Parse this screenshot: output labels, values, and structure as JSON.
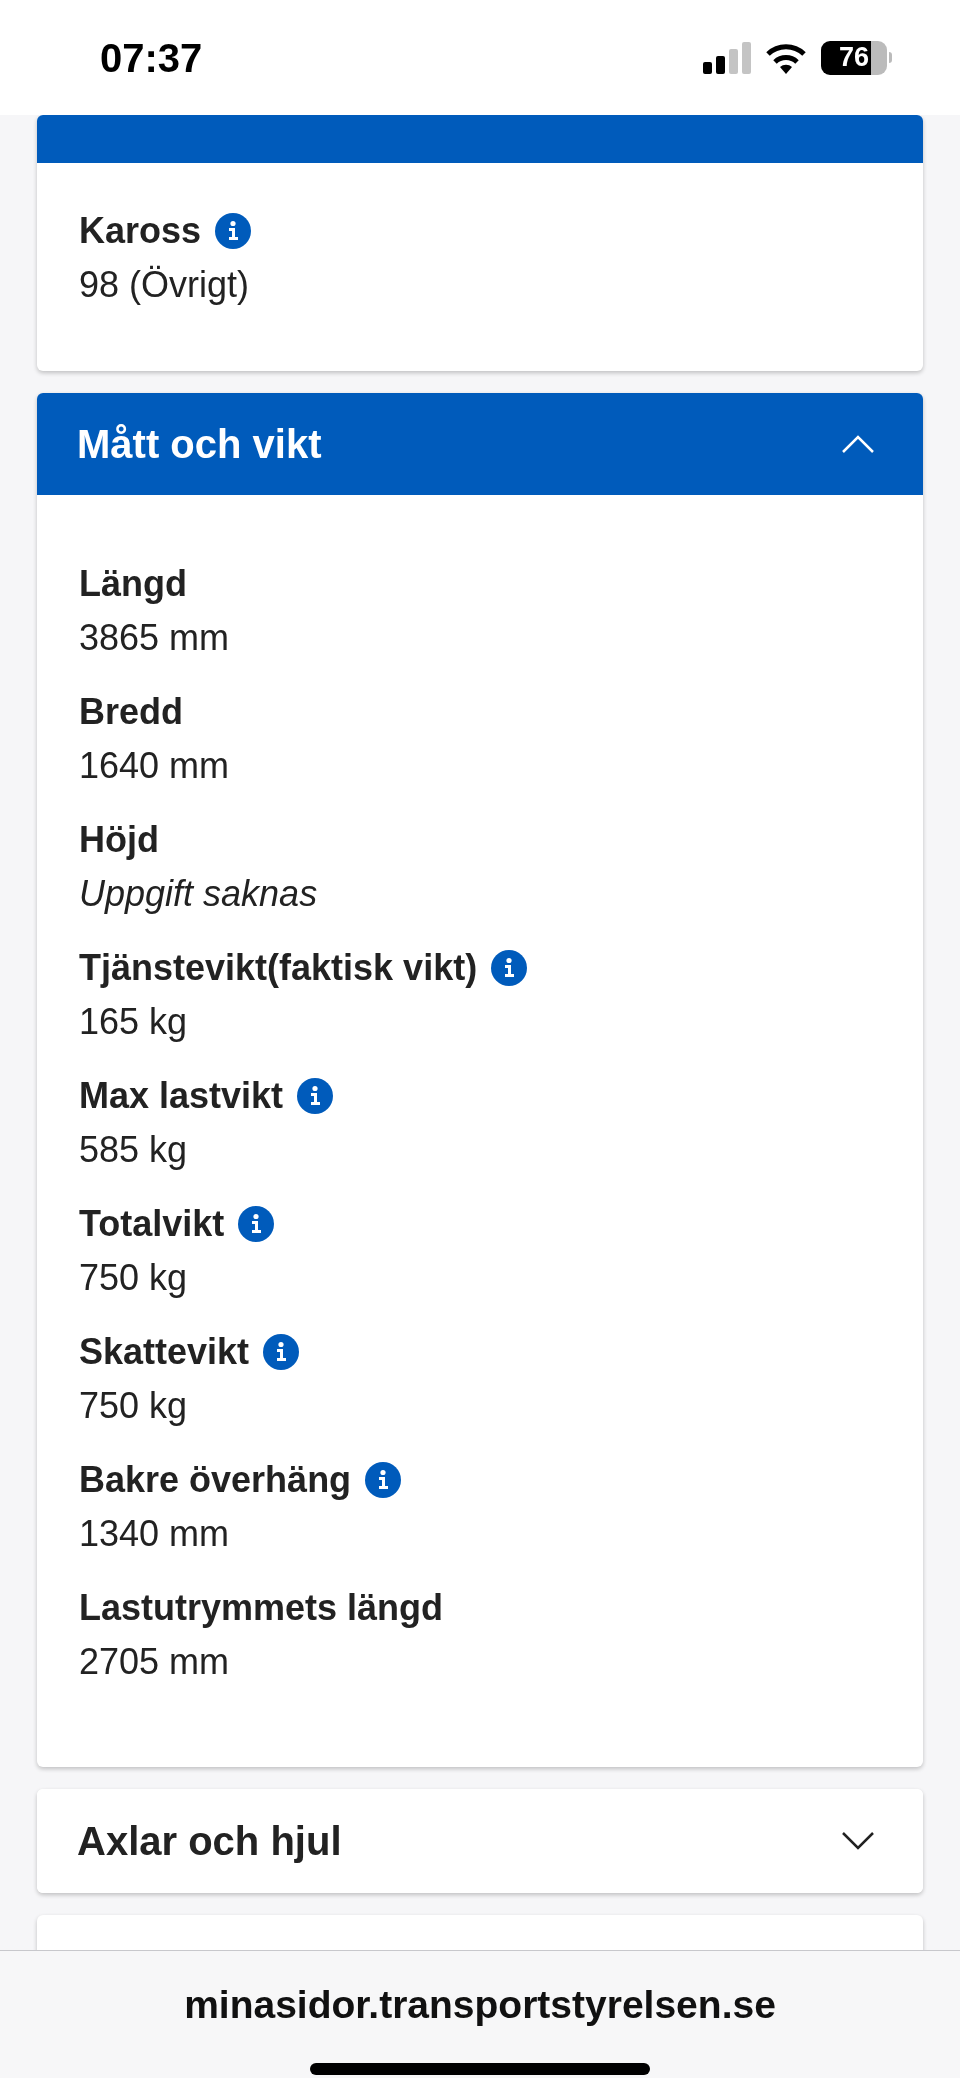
{
  "status_bar": {
    "time": "07:37",
    "battery": "76"
  },
  "sections": [
    {
      "fields": [
        {
          "label": "Kaross",
          "value": "98 (Övrigt)",
          "info": true,
          "missing": false
        }
      ]
    },
    {
      "title": "Mått och vikt",
      "expanded": true,
      "fields": [
        {
          "label": "Längd",
          "value": "3865 mm",
          "info": false,
          "missing": false
        },
        {
          "label": "Bredd",
          "value": "1640 mm",
          "info": false,
          "missing": false
        },
        {
          "label": "Höjd",
          "value": "Uppgift saknas",
          "info": false,
          "missing": true
        },
        {
          "label": "Tjänstevikt(faktisk vikt)",
          "value": "165 kg",
          "info": true,
          "missing": false
        },
        {
          "label": "Max lastvikt",
          "value": "585 kg",
          "info": true,
          "missing": false
        },
        {
          "label": "Totalvikt",
          "value": "750 kg",
          "info": true,
          "missing": false
        },
        {
          "label": "Skattevikt",
          "value": "750 kg",
          "info": true,
          "missing": false
        },
        {
          "label": "Bakre överhäng",
          "value": "1340 mm",
          "info": true,
          "missing": false
        },
        {
          "label": "Lastutrymmets längd",
          "value": "2705 mm",
          "info": false,
          "missing": false
        }
      ]
    },
    {
      "title": "Axlar och hjul",
      "expanded": false
    }
  ],
  "browser": {
    "url": "minasidor.transportstyrelsen.se"
  }
}
